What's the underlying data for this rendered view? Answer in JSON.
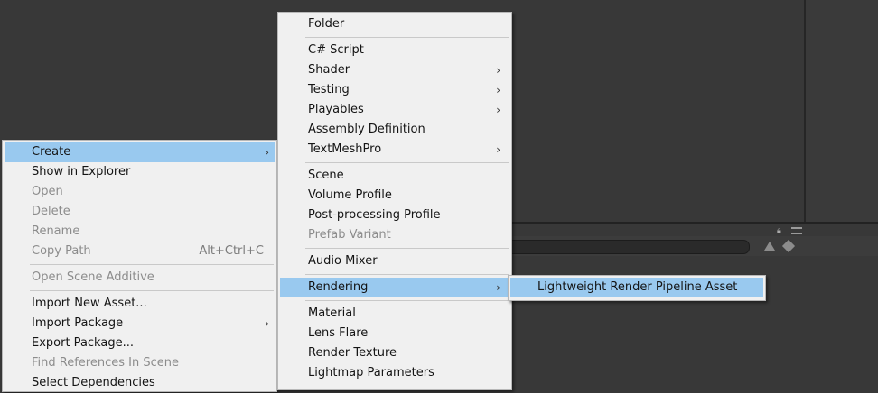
{
  "context_menu": {
    "items": [
      {
        "label": "Create",
        "submenu": true,
        "highlighted": true
      },
      {
        "label": "Show in Explorer"
      },
      {
        "label": "Open",
        "disabled": true
      },
      {
        "label": "Delete",
        "disabled": true
      },
      {
        "label": "Rename",
        "disabled": true
      },
      {
        "label": "Copy Path",
        "shortcut": "Alt+Ctrl+C",
        "disabled": true
      },
      {
        "label": "Open Scene Additive",
        "disabled": true
      },
      {
        "label": "Import New Asset..."
      },
      {
        "label": "Import Package",
        "submenu": true
      },
      {
        "label": "Export Package..."
      },
      {
        "label": "Find References In Scene",
        "disabled": true
      },
      {
        "label": "Select Dependencies"
      }
    ]
  },
  "create_menu": {
    "items": [
      {
        "label": "Folder"
      },
      {
        "label": "C# Script"
      },
      {
        "label": "Shader",
        "submenu": true
      },
      {
        "label": "Testing",
        "submenu": true
      },
      {
        "label": "Playables",
        "submenu": true
      },
      {
        "label": "Assembly Definition"
      },
      {
        "label": "TextMeshPro",
        "submenu": true
      },
      {
        "label": "Scene"
      },
      {
        "label": "Volume Profile"
      },
      {
        "label": "Post-processing Profile"
      },
      {
        "label": "Prefab Variant",
        "disabled": true
      },
      {
        "label": "Audio Mixer"
      },
      {
        "label": "Rendering",
        "submenu": true,
        "highlighted": true
      },
      {
        "label": "Material"
      },
      {
        "label": "Lens Flare"
      },
      {
        "label": "Render Texture"
      },
      {
        "label": "Lightmap Parameters"
      }
    ]
  },
  "rendering_menu": {
    "items": [
      {
        "label": "Lightweight Render Pipeline Asset",
        "highlighted": true
      }
    ]
  },
  "glyphs": {
    "arrow": "›"
  },
  "colors": {
    "highlight": "#99c9ef",
    "background": "#383838",
    "menu": "#f0f0f0"
  },
  "icons": [
    "lock-icon",
    "panel-menu-icon",
    "filter-by-type-icon",
    "filter-by-label-icon"
  ]
}
